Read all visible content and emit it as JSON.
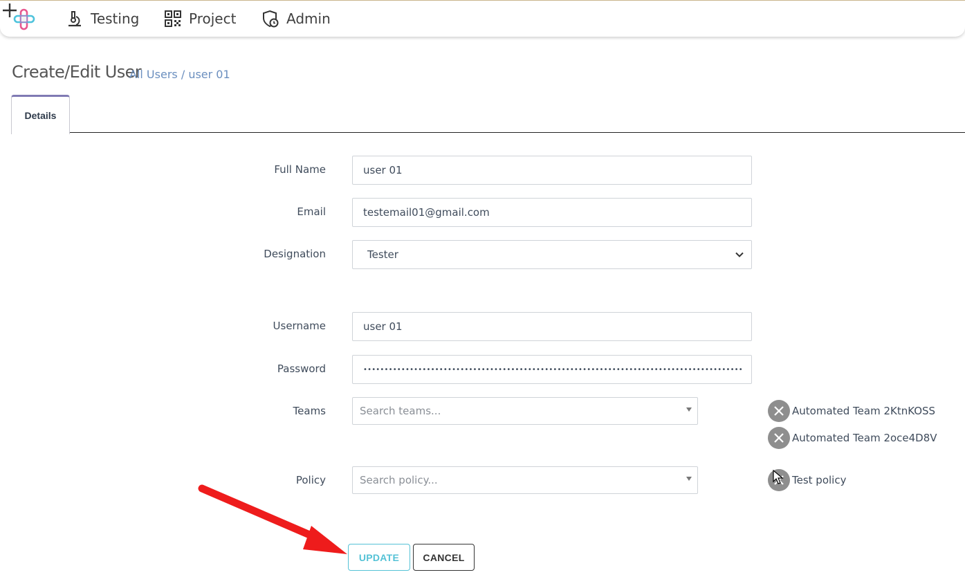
{
  "nav": {
    "items": [
      {
        "label": "Testing",
        "icon": "microscope-icon"
      },
      {
        "label": "Project",
        "icon": "qr-grid-icon"
      },
      {
        "label": "Admin",
        "icon": "shield-clock-icon"
      }
    ],
    "add_icon": "plus-icon"
  },
  "header": {
    "title": "Create/Edit User",
    "breadcrumb": {
      "link": "All Users",
      "separator": "/",
      "current": "user 01"
    }
  },
  "tabs": [
    {
      "label": "Details",
      "active": true
    }
  ],
  "form": {
    "full_name": {
      "label": "Full Name",
      "value": "user 01"
    },
    "email": {
      "label": "Email",
      "value": "testemail01@gmail.com"
    },
    "designation": {
      "label": "Designation",
      "value": "Tester"
    },
    "username": {
      "label": "Username",
      "value": "user 01"
    },
    "password": {
      "label": "Password",
      "value": "••••••••••••••••••••••••••••••••••••••••••••••••••••••••••••••••••••••••••••••••••••••••••••••••"
    },
    "teams": {
      "label": "Teams",
      "placeholder": "Search teams...",
      "selected": [
        "Automated Team 2KtnKOSS",
        "Automated Team 2oce4D8V"
      ]
    },
    "policy": {
      "label": "Policy",
      "placeholder": "Search policy...",
      "selected": [
        "Test policy"
      ]
    }
  },
  "actions": {
    "update_label": "UPDATE",
    "cancel_label": "CANCEL"
  },
  "colors": {
    "accent": "#54c2d6",
    "tab_accent": "#7f7ab3",
    "link": "#6b8fbf",
    "annotation_arrow": "#ee1c1c"
  }
}
